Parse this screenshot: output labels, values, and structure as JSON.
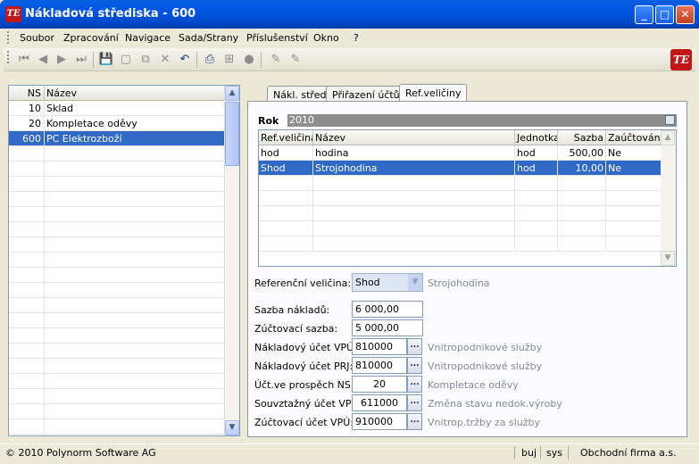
{
  "window": {
    "title": "Nákladová střediska - 600",
    "icon": "app-logo-icon",
    "buttons": {
      "minimize": "_",
      "maximize": "□",
      "close": "✕"
    }
  },
  "menu": [
    "Soubor",
    "Zpracování",
    "Navigace",
    "Sada/Strany",
    "Příslušenství",
    "Okno",
    "?"
  ],
  "toolbar": {
    "icons": [
      "first-record-icon",
      "prev-record-icon",
      "next-record-icon",
      "last-record-icon",
      "save-icon",
      "new-icon",
      "copy-icon",
      "delete-icon",
      "undo-icon",
      "print-icon",
      "tree-icon",
      "stop-icon",
      "edit-icon",
      "edit2-icon"
    ]
  },
  "left_grid": {
    "columns": [
      "NS",
      "Název"
    ],
    "rows": [
      {
        "ns": "10",
        "name": "Sklad"
      },
      {
        "ns": "20",
        "name": "Kompletace oděvy"
      },
      {
        "ns": "600",
        "name": "PC Elektrozboží"
      }
    ],
    "selected_index": 2
  },
  "tabs": [
    "Nákl. střed.",
    "Přiřazení účtů",
    "Ref.veličiny"
  ],
  "active_tab": 2,
  "rok": {
    "label": "Rok",
    "value": "2010"
  },
  "ref_grid": {
    "columns": [
      "Ref.veličina",
      "Název",
      "Jednotka",
      "Sazba",
      "Zaúčtováno"
    ],
    "rows": [
      [
        "hod",
        "hodina",
        "hod",
        "500,00",
        "Ne"
      ],
      [
        "Shod",
        "Strojohodina",
        "hod",
        "10,00",
        "Ne"
      ]
    ],
    "selected_index": 1
  },
  "form": {
    "ref_velicina": {
      "label": "Referenční veličina:",
      "value": "Shod",
      "desc": "Strojohodina"
    },
    "sazba_nakladu": {
      "label": "Sazba nákladů:",
      "value": "6 000,00"
    },
    "zuctovaci_sazba": {
      "label": "Zúčtovací sazba:",
      "value": "5 000,00"
    },
    "nakl_ucet_vpu": {
      "label": "Nákladový účet VPÚ:",
      "value": "810000",
      "desc": "Vnitropodnikové služby"
    },
    "nakl_ucet_prj": {
      "label": "Nákladový účet PRJ:",
      "value": "810000",
      "desc": "Vnitropodnikové služby"
    },
    "uct_prospech_ns": {
      "label": "Účt.ve prospěch NS:",
      "value": "20",
      "desc": "Kompletace oděvy"
    },
    "souvztazny_ucet": {
      "label": "Souvztažný účet VPÚ:",
      "value": "611000",
      "desc": "Změna stavu nedok.výroby"
    },
    "zuctovaci_ucet": {
      "label": "Zúčtovací účet VPÚ:",
      "value": "910000",
      "desc": "Vnitrop.tržby za služby"
    },
    "lookup_label": "..."
  },
  "status": {
    "copyright": "© 2010 Polynorm Software AG",
    "cell1": "buj",
    "cell2": "sys",
    "company": "Obchodní firma a.s."
  }
}
